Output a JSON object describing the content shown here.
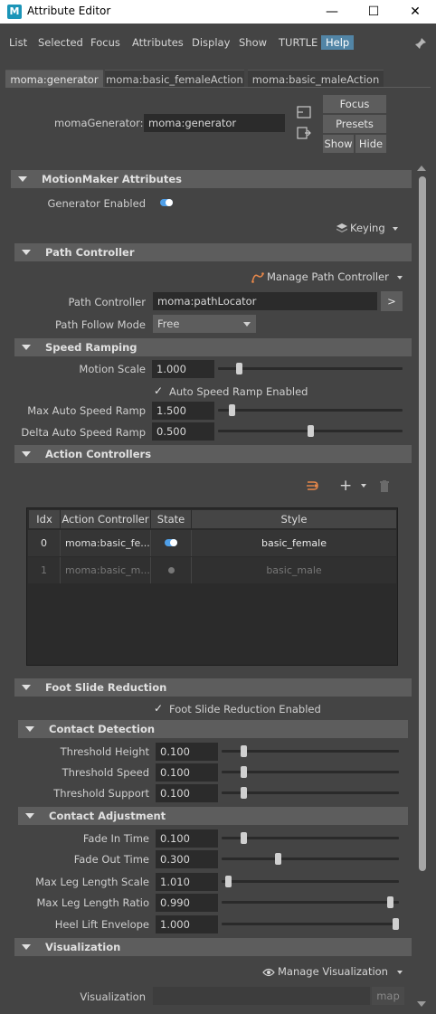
{
  "window": {
    "title": "Attribute Editor",
    "app_icon_letter": "M",
    "minimize": "—",
    "maximize": "☐",
    "close": "✕"
  },
  "menu": [
    "List",
    "Selected",
    "Focus",
    "Attributes",
    "Display",
    "Show",
    "TURTLE",
    "Help"
  ],
  "tabs": [
    "moma:generator",
    "moma:basic_femaleAction",
    "moma:basic_maleAction"
  ],
  "node": {
    "label": "momaGenerator:",
    "value": "moma:generator"
  },
  "buttons": {
    "focus": "Focus",
    "presets": "Presets",
    "show": "Show",
    "hide": "Hide"
  },
  "sections": {
    "motionmaker": {
      "title": "MotionMaker Attributes",
      "generator_enabled_label": "Generator Enabled",
      "generator_enabled": true,
      "keying_label": "Keying"
    },
    "path": {
      "title": "Path Controller",
      "manage_label": "Manage Path Controller",
      "controller_label": "Path Controller",
      "controller_value": "moma:pathLocator",
      "goto_label": ">",
      "follow_label": "Path Follow Mode",
      "follow_value": "Free"
    },
    "speed": {
      "title": "Speed Ramping",
      "motion_scale_label": "Motion Scale",
      "motion_scale_value": "1.000",
      "motion_scale_pos": 0.1,
      "auto_label": "Auto Speed Ramp Enabled",
      "max_label": "Max Auto Speed Ramp",
      "max_value": "1.500",
      "max_pos": 0.06,
      "delta_label": "Delta Auto Speed Ramp",
      "delta_value": "0.500",
      "delta_pos": 0.5
    },
    "action": {
      "title": "Action Controllers",
      "columns": [
        "Idx",
        "Action Controller",
        "State",
        "Style"
      ],
      "rows": [
        {
          "idx": "0",
          "controller": "moma:basic_fe...",
          "state": "on",
          "style": "basic_female"
        },
        {
          "idx": "1",
          "controller": "moma:basic_m...",
          "state": "off",
          "style": "basic_male"
        }
      ]
    },
    "foot": {
      "title": "Foot Slide Reduction",
      "enabled_label": "Foot Slide Reduction Enabled"
    },
    "contact_detection": {
      "title": "Contact Detection",
      "fields": [
        {
          "label": "Threshold Height",
          "value": "0.100",
          "pos": 0.11
        },
        {
          "label": "Threshold Speed",
          "value": "0.100",
          "pos": 0.11
        },
        {
          "label": "Threshold Support",
          "value": "0.100",
          "pos": 0.11
        }
      ]
    },
    "contact_adjustment": {
      "title": "Contact Adjustment",
      "fields": [
        {
          "label": "Fade In Time",
          "value": "0.100",
          "pos": 0.11
        },
        {
          "label": "Fade Out Time",
          "value": "0.300",
          "pos": 0.31
        },
        {
          "label": "Max Leg Length Scale",
          "value": "1.010",
          "pos": 0.02
        },
        {
          "label": "Max Leg Length Ratio",
          "value": "0.990",
          "pos": 0.97
        },
        {
          "label": "Heel Lift Envelope",
          "value": "1.000",
          "pos": 1.0
        }
      ]
    },
    "visualization": {
      "title": "Visualization",
      "manage_label": "Manage Visualization",
      "field_label": "Visualization",
      "map_label": "map"
    }
  },
  "colors": {
    "accent": "#4f9fe8",
    "panel": "#444444",
    "header": "#5d5d5d",
    "field": "#2b2b2b",
    "help_bg": "#5285a6"
  }
}
